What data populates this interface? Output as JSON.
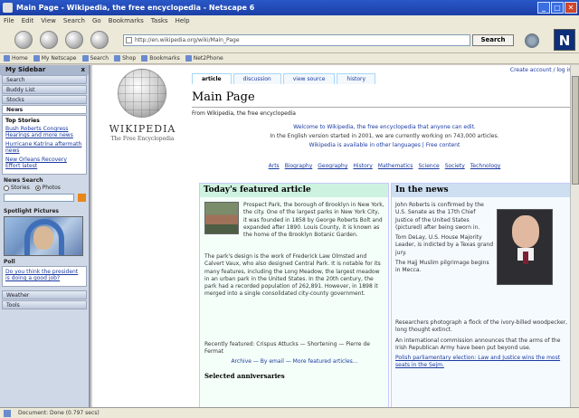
{
  "window": {
    "title": "Main Page - Wikipedia, the free encyclopedia - Netscape 6",
    "min": "_",
    "max": "□",
    "close": "✕"
  },
  "menu": [
    "File",
    "Edit",
    "View",
    "Search",
    "Go",
    "Bookmarks",
    "Tasks",
    "Help"
  ],
  "nav": {
    "url": "http://en.wikipedia.org/wiki/Main_Page",
    "search_label": "Search",
    "logo_letter": "N"
  },
  "bookmarks": [
    "Home",
    "My Netscape",
    "Search",
    "Shop",
    "Bookmarks",
    "Net2Phone"
  ],
  "sidebar": {
    "header": "My Sidebar",
    "close": "x",
    "tabs": [
      "Search",
      "Buddy List",
      "Stocks",
      "News"
    ],
    "active_tab": "News",
    "panel_title": "Top Stories",
    "stories": [
      "Bush Roberts Congress Hearings and more news",
      "Hurricane Katrina aftermath news",
      "New Orleans Recovery Effort latest"
    ],
    "search_label": "News Search",
    "search_options": [
      "Stories",
      "Photos"
    ],
    "photo_label": "Spotlight Pictures",
    "poll_label": "Poll",
    "poll_question": "Do you think the president is doing a good job?",
    "bottom_tabs": [
      "Weather",
      "Tools"
    ]
  },
  "page": {
    "tabs": [
      "article",
      "discussion",
      "view source",
      "history"
    ],
    "login": "Create account / log in",
    "title": "Main Page",
    "from": "From Wikipedia, the free encyclopedia",
    "welcome_1": "Welcome to Wikipedia, the free encyclopedia that anyone can edit.",
    "welcome_2": "In the English version started in 2001, we are currently working on 743,000 articles.",
    "welcome_3": "Wikipedia is available in other languages | Free content",
    "portals": [
      "Arts",
      "Biography",
      "Geography",
      "History",
      "Mathematics",
      "Science",
      "Society",
      "Technology"
    ],
    "logo_name": "WIKIPEDIA",
    "logo_sub": "The Free Encyclopedia"
  },
  "featured": {
    "heading": "Today's featured article",
    "text_1": "Prospect Park, the borough of Brooklyn in New York, the city. One of the largest parks in New York City, it was founded in 1858 by George Roberts Bolt and expanded after 1890. Louis County, it is known as the home of the Brooklyn Botanic Garden.",
    "text_2": "The park's design is the work of Frederick Law Olmsted and Calvert Vaux, who also designed Central Park. It is notable for its many features, including the Long Meadow, the largest meadow in an urban park in the United States. In the 20th century, the park had a recorded population of 262,891. However, in 1898 it merged into a single consolidated city-county government.",
    "recent": "Recently featured: Crispus Attucks — Shortening — Pierre de Fermat",
    "more": "Archive — By email — More featured articles...",
    "selected": "Selected anniversaries"
  },
  "news": {
    "heading": "In the news",
    "items": [
      "John Roberts is confirmed by the U.S. Senate as the 17th Chief Justice of the United States (pictured) after being sworn in.",
      "Tom DeLay, U.S. House Majority Leader, is indicted by a Texas grand jury.",
      "The Hajj Muslim pilgrimage begins in Mecca."
    ],
    "items_2": [
      "Researchers photograph a flock of the ivory-billed woodpecker, long thought extinct.",
      "An international commission announces that the arms of the Irish Republican Army have been put beyond use.",
      "Polish parliamentary election: Law and Justice wins the most seats in the Sejm."
    ]
  },
  "status": "Document: Done (0.797 secs)"
}
